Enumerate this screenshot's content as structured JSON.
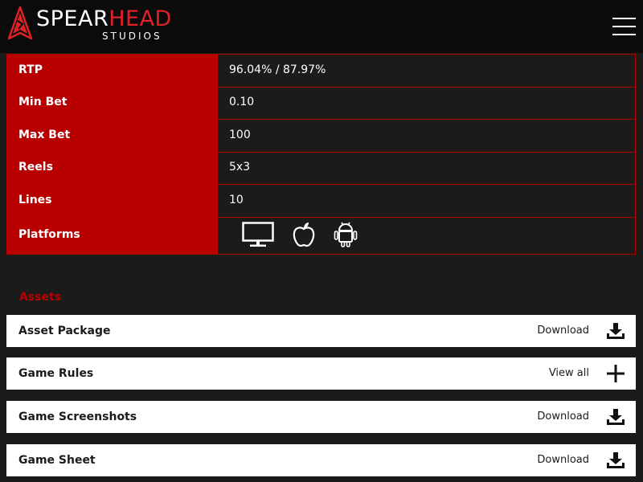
{
  "header": {
    "logo_main_white": "SPEAR",
    "logo_main_red": "HEAD",
    "logo_sub": "STUDIOS",
    "logo_icon": "spearhead-logo-icon",
    "menu_icon": "hamburger-menu-icon"
  },
  "info": {
    "rows": [
      {
        "label": "RTP",
        "value": "96.04% / 87.97%"
      },
      {
        "label": "Min Bet",
        "value": "0.10"
      },
      {
        "label": "Max Bet",
        "value": "100"
      },
      {
        "label": "Reels",
        "value": "5x3"
      },
      {
        "label": "Lines",
        "value": "10"
      },
      {
        "label": "Platforms",
        "value": ""
      }
    ],
    "platforms": [
      "desktop-icon",
      "apple-icon",
      "android-icon"
    ]
  },
  "assets": {
    "title": "Assets",
    "items": [
      {
        "name": "Asset Package",
        "action": "Download",
        "icon": "download-icon"
      },
      {
        "name": "Game Rules",
        "action": "View all",
        "icon": "plus-icon"
      },
      {
        "name": "Game Screenshots",
        "action": "Download",
        "icon": "download-icon"
      },
      {
        "name": "Game Sheet",
        "action": "Download",
        "icon": "download-icon"
      }
    ]
  },
  "colors": {
    "accent_red": "#b80000",
    "logo_red": "#e02227",
    "background": "#1b1b1b",
    "header_bg": "#0b0b0b"
  }
}
